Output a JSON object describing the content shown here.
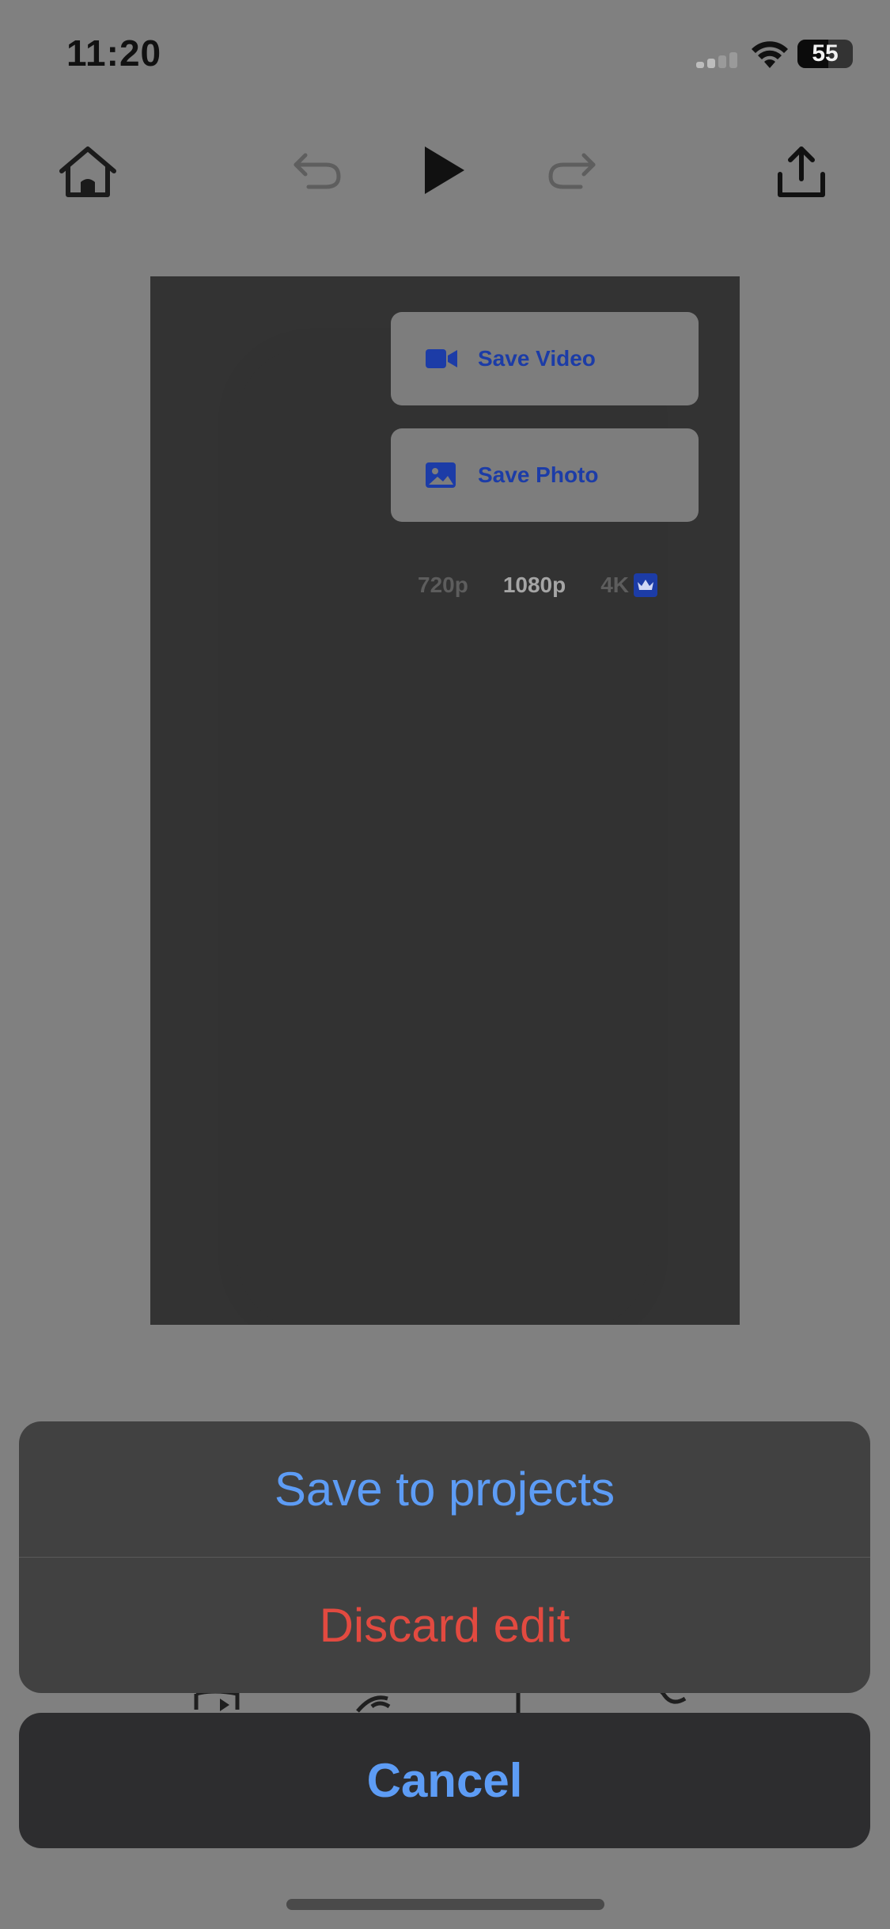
{
  "status_bar": {
    "time": "11:20",
    "battery_level": 55,
    "battery_label": "55"
  },
  "toolbar": {
    "icons": [
      "home-icon",
      "undo-icon",
      "play-icon",
      "redo-icon",
      "share-icon"
    ]
  },
  "export_panel": {
    "save_video_label": "Save Video",
    "save_photo_label": "Save Photo",
    "resolutions": [
      "720p",
      "1080p",
      "4K"
    ],
    "selected_resolution": "1080p",
    "accent_color": "#1c3ca7"
  },
  "action_sheet": {
    "save_to_projects_label": "Save to projects",
    "discard_label": "Discard edit",
    "cancel_label": "Cancel",
    "action_color": "#5d9cf5",
    "destructive_color": "#e24a40"
  }
}
